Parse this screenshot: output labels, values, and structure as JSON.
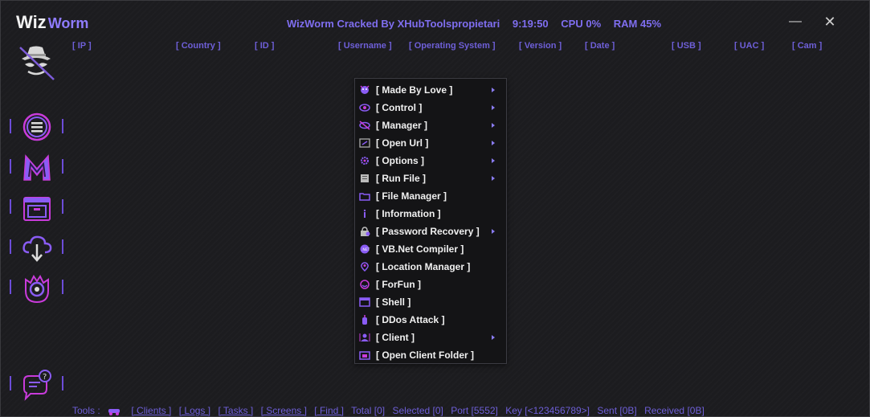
{
  "app": {
    "brand_primary": "Wiz",
    "brand_secondary": "Worm",
    "title": "WizWorm Cracked By XHubToolspropietari",
    "time": "9:19:50",
    "cpu": "CPU 0%",
    "ram": "RAM 45%",
    "minimize_label": "—",
    "close_label": "✕"
  },
  "columns": [
    "[ IP ]",
    "[ Country ]",
    "[ ID ]",
    "[ Username ]",
    "[ Operating System ]",
    "[ Version ]",
    "[ Date ]",
    "[ USB ]",
    "[ UAC ]",
    "[ Cam ]"
  ],
  "sidebar": {
    "logo_icon": "spy-hat-icon",
    "items": [
      {
        "icon": "menu-list-icon"
      },
      {
        "icon": "malware-m-icon"
      },
      {
        "icon": "folder-window-icon"
      },
      {
        "icon": "cloud-download-icon"
      },
      {
        "icon": "monster-eye-icon"
      },
      {
        "icon": "chat-help-icon"
      }
    ]
  },
  "context_menu": {
    "items": [
      {
        "label": "[ Made By Love ]",
        "submenu": true,
        "icon": "devil-face-icon"
      },
      {
        "label": "[ Control ]",
        "submenu": true,
        "icon": "eye-icon"
      },
      {
        "label": "[ Manager ]",
        "submenu": true,
        "icon": "hidden-eye-icon"
      },
      {
        "label": "[ Open Url ]",
        "submenu": true,
        "icon": "url-window-icon"
      },
      {
        "label": "[ Options ]",
        "submenu": true,
        "icon": "gear-icon"
      },
      {
        "label": "[ Run File ]",
        "submenu": true,
        "icon": "run-file-icon"
      },
      {
        "label": "[ File Manager ]",
        "submenu": false,
        "icon": "folder-icon"
      },
      {
        "label": "[ Information ]",
        "submenu": false,
        "icon": "info-icon"
      },
      {
        "label": "[ Password Recovery ]",
        "submenu": true,
        "icon": "lock-icon"
      },
      {
        "label": "[ VB.Net Compiler ]",
        "submenu": false,
        "icon": "dotnet-icon"
      },
      {
        "label": "[ Location Manager ]",
        "submenu": false,
        "icon": "location-pin-icon"
      },
      {
        "label": "[ ForFun ]",
        "submenu": false,
        "icon": "fun-face-icon"
      },
      {
        "label": "[ Shell ]",
        "submenu": false,
        "icon": "shell-window-icon"
      },
      {
        "label": "[ DDos Attack ]",
        "submenu": false,
        "icon": "bomb-icon"
      },
      {
        "label": "[ Client ]",
        "submenu": true,
        "icon": "client-user-icon"
      },
      {
        "label": "[ Open Client Folder ]",
        "submenu": false,
        "icon": "open-folder-icon"
      }
    ]
  },
  "statusbar": {
    "tools_label": "Tools :",
    "links": [
      "[ Clients ]",
      "[ Logs ]",
      "[ Tasks ]",
      "[ Screens ]",
      "[ Find ]"
    ],
    "total": "Total [0]",
    "selected": "Selected [0]",
    "port": "Port [5552]",
    "key": "Key [<123456789>]",
    "sent": "Sent [0B]",
    "received": "Received [0B]"
  },
  "colors": {
    "accent": "#6e5fd8",
    "title_accent": "#7f6ef0",
    "icon_pink": "#c93bdb",
    "icon_purple": "#8a5cf5",
    "background": "#1c1c1f",
    "menu_background": "#141416"
  }
}
